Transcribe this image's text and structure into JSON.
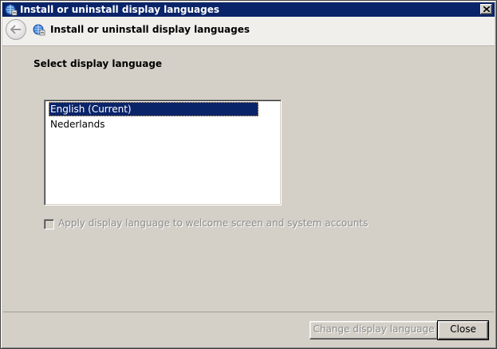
{
  "window": {
    "title": "Install or uninstall display languages"
  },
  "nav": {
    "title": "Install or uninstall display languages"
  },
  "content": {
    "heading": "Select display language",
    "languages": [
      {
        "label": "English (Current)",
        "selected": true
      },
      {
        "label": "Nederlands",
        "selected": false
      }
    ],
    "apply_checkbox": {
      "label": "Apply display language to welcome screen and system accounts",
      "checked": false,
      "enabled": false
    }
  },
  "footer": {
    "change_button": "Change display language",
    "close_button": "Close"
  },
  "colors": {
    "title_bar": "#0a246a",
    "selection": "#0a246a",
    "face": "#d4d0c8"
  }
}
